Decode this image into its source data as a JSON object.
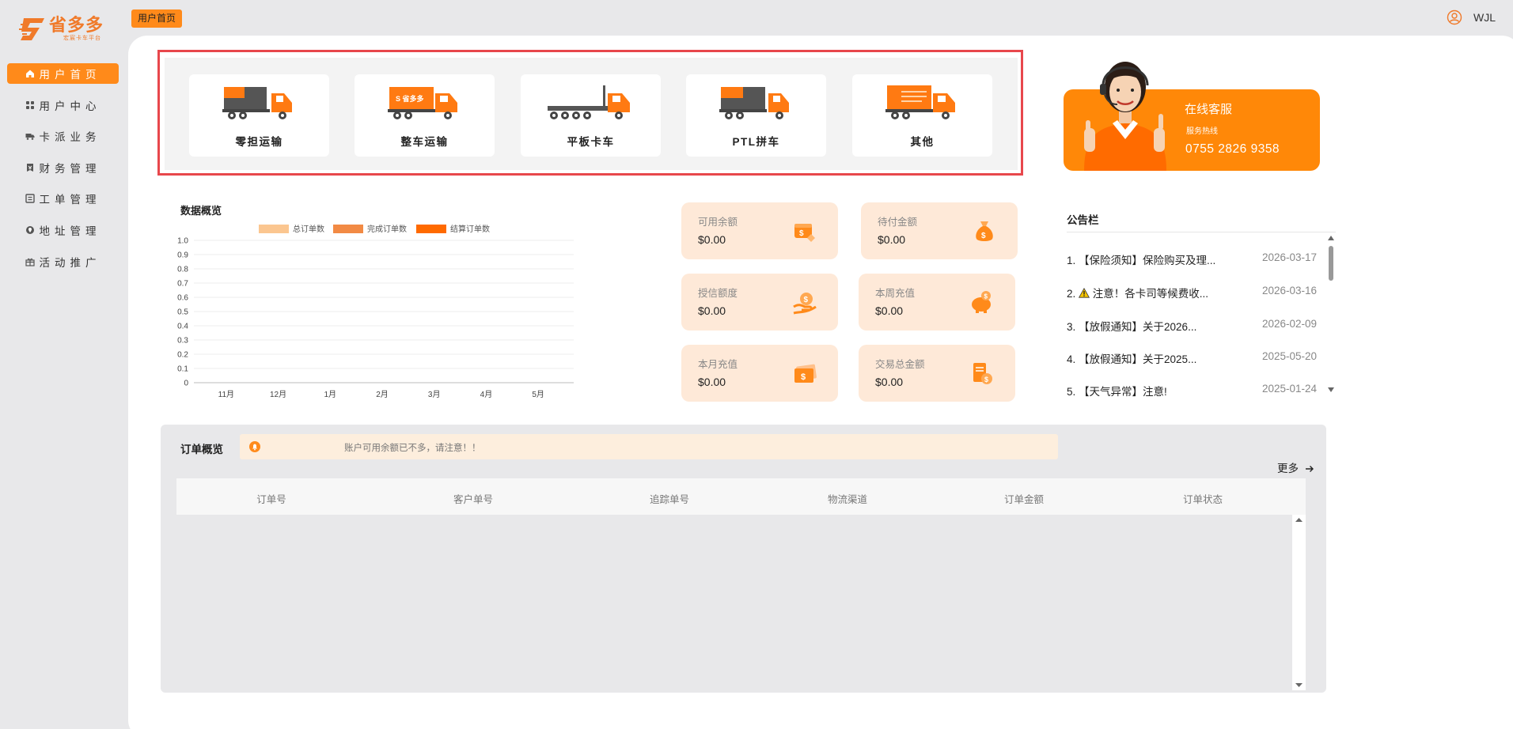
{
  "brand": {
    "name": "省多多",
    "slogan": "宏宸卡车平台",
    "color": "#f07a2a"
  },
  "topbar": {
    "tab_label": "用户首页",
    "username": "WJL"
  },
  "sidebar": {
    "items": [
      {
        "label": "用户首页",
        "icon": "home-icon",
        "active": true
      },
      {
        "label": "用户中心",
        "icon": "grid-icon",
        "active": false
      },
      {
        "label": "卡派业务",
        "icon": "truck-icon",
        "active": false
      },
      {
        "label": "财务管理",
        "icon": "finance-icon",
        "active": false
      },
      {
        "label": "工单管理",
        "icon": "ticket-icon",
        "active": false
      },
      {
        "label": "地址管理",
        "icon": "location-icon",
        "active": false
      },
      {
        "label": "活动推广",
        "icon": "gift-icon",
        "active": false
      }
    ]
  },
  "transport": [
    {
      "label": "零担运输",
      "icon": "ltl-truck-icon"
    },
    {
      "label": "整车运输",
      "icon": "ftl-truck-icon"
    },
    {
      "label": "平板卡车",
      "icon": "flatbed-truck-icon"
    },
    {
      "label": "PTL拼车",
      "icon": "ptl-truck-icon"
    },
    {
      "label": "其他",
      "icon": "box-truck-icon"
    }
  ],
  "customer_service": {
    "title": "在线客服",
    "subtitle": "服务热线",
    "phone": "0755 2826 9358"
  },
  "overview": {
    "title": "数据概览"
  },
  "chart_data": {
    "type": "bar",
    "title": "数据概览",
    "categories": [
      "11月",
      "12月",
      "1月",
      "2月",
      "3月",
      "4月",
      "5月"
    ],
    "series": [
      {
        "name": "总订单数",
        "color": "#fbc690",
        "values": [
          0,
          0,
          0,
          0,
          0,
          0,
          0
        ]
      },
      {
        "name": "完成订单数",
        "color": "#f28a44",
        "values": [
          0,
          0,
          0,
          0,
          0,
          0,
          0
        ]
      },
      {
        "name": "结算订单数",
        "color": "#ff6a00",
        "values": [
          0,
          0,
          0,
          0,
          0,
          0,
          0
        ]
      }
    ],
    "yticks": [
      "1.0",
      "0.9",
      "0.8",
      "0.7",
      "0.6",
      "0.5",
      "0.4",
      "0.3",
      "0.2",
      "0.1",
      "0"
    ],
    "ylim": [
      0,
      1.0
    ],
    "grid": true,
    "legend": "top-center"
  },
  "stats": [
    {
      "label": "可用余额",
      "value": "$0.00",
      "icon": "wallet-coin-icon"
    },
    {
      "label": "待付金额",
      "value": "$0.00",
      "icon": "money-bag-icon"
    },
    {
      "label": "授信额度",
      "value": "$0.00",
      "icon": "hand-coin-icon"
    },
    {
      "label": "本周充值",
      "value": "$0.00",
      "icon": "piggy-bank-icon"
    },
    {
      "label": "本月充值",
      "value": "$0.00",
      "icon": "cash-ticket-icon"
    },
    {
      "label": "交易总金额",
      "value": "$0.00",
      "icon": "bill-coin-icon"
    }
  ],
  "notices": {
    "title": "公告栏",
    "items": [
      {
        "num": "1.",
        "text": "【保险须知】保险购买及理...",
        "date": "2026-03-17",
        "warn": false
      },
      {
        "num": "2.",
        "text": "注意！各卡司等候费收...",
        "date": "2026-03-16",
        "warn": true
      },
      {
        "num": "3.",
        "text": "【放假通知】关于2026...",
        "date": "2026-02-09",
        "warn": false
      },
      {
        "num": "4.",
        "text": "【放假通知】关于2025...",
        "date": "2025-05-20",
        "warn": false
      },
      {
        "num": "5.",
        "text": "【天气异常】注意!",
        "date": "2025-01-24",
        "warn": false
      }
    ]
  },
  "orders": {
    "title": "订单概览",
    "alert": "账户可用余额已不多，请注意！！",
    "more": "更多",
    "columns": [
      "订单号",
      "客户单号",
      "追踪单号",
      "物流渠道",
      "订单金额",
      "订单状态"
    ]
  }
}
